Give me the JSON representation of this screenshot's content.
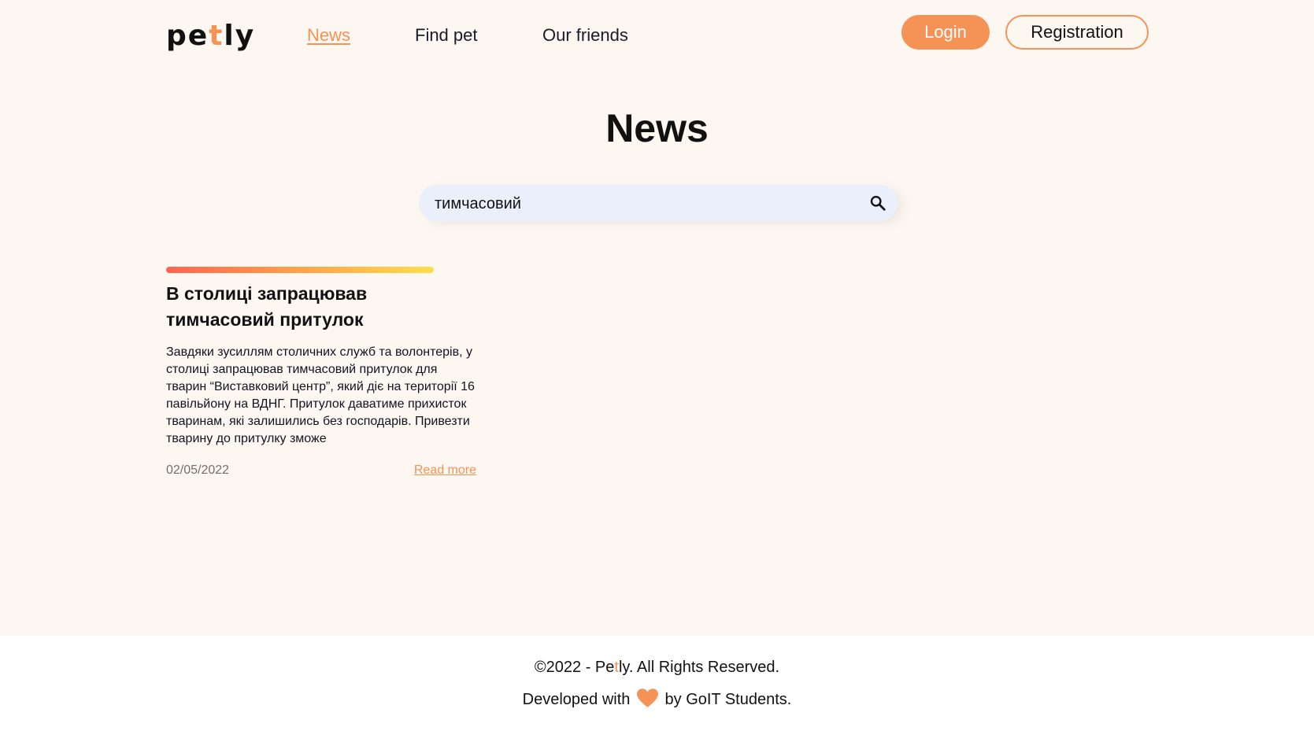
{
  "header": {
    "logo": {
      "part1": "pe",
      "accent": "t",
      "part2": "ly"
    },
    "nav": [
      {
        "label": "News",
        "active": true
      },
      {
        "label": "Find pet",
        "active": false
      },
      {
        "label": "Our friends",
        "active": false
      }
    ],
    "login_label": "Login",
    "registration_label": "Registration"
  },
  "main": {
    "title": "News",
    "search": {
      "value": "тимчасовий",
      "placeholder": "Search",
      "icon": "search-icon"
    },
    "news": [
      {
        "title": "В столиці запрацював тимчасовий притулок",
        "text": "Завдяки зусиллям столичних служб та волонтерів, у столиці запрацював тимчасовий притулок для тварин “Виставковий центр”, який діє на території 16 павільйону на ВДНГ. Притулок даватиме прихисток тваринам, які залишились без господарів. Привезти тварину до притулку зможе",
        "date": "02/05/2022",
        "read_more": "Read more"
      }
    ]
  },
  "footer": {
    "copyright_prefix": "©2022 - Pe",
    "copyright_accent": "t",
    "copyright_suffix": "ly. All Rights Reserved.",
    "developed_prefix": "Developed with",
    "developed_icon": "heart-icon",
    "developed_suffix": "by GoIT Students."
  },
  "colors": {
    "accent": "#f59256",
    "background": "#fdf7f2",
    "search_background": "#e9f0fb",
    "gradient_start": "#ff634e",
    "gradient_end": "#ffdf48"
  }
}
